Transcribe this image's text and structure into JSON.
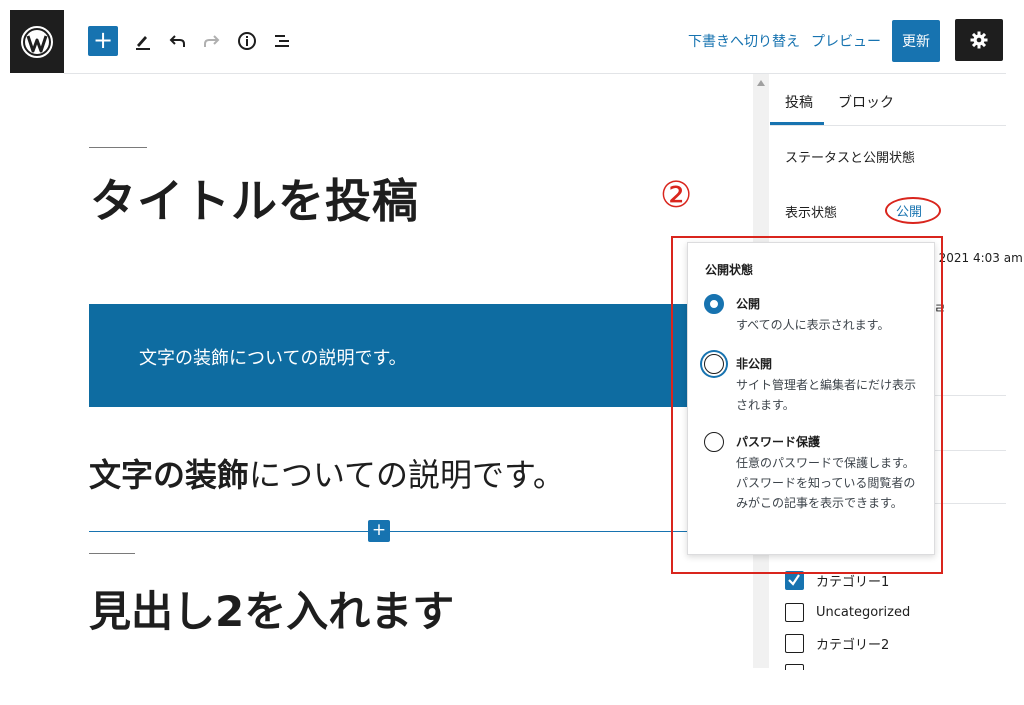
{
  "toolbar": {
    "switch_to_draft": "下書きへ切り替え",
    "preview": "プレビュー",
    "update": "更新",
    "add_symbol": "+"
  },
  "editor": {
    "title": "タイトルを投稿",
    "cover_text": "文字の装飾についての説明です。",
    "paragraph_bold": "文字の装飾",
    "paragraph_rest": "についての説明です。",
    "inserter_symbol": "+",
    "heading2": "見出し2を入れます"
  },
  "sidebar": {
    "tabs": [
      "投稿",
      "ブロック"
    ],
    "status_panel_title": "ステータスと公開状態",
    "visibility_label": "表示状態",
    "visibility_value": "公開",
    "publish_date_partial": ", 2021 4:03 am",
    "obscured_char": "ㄹ"
  },
  "annotation": {
    "step_marker": "②"
  },
  "visibility_popover": {
    "title": "公開状態",
    "options": [
      {
        "label": "公開",
        "description": "すべての人に表示されます。",
        "selected": true
      },
      {
        "label": "非公開",
        "description": "サイト管理者と編集者にだけ表示されます。",
        "selected": false
      },
      {
        "label": "パスワード保護",
        "description": "任意のパスワードで保護します。パスワードを知っている閲覧者のみがこの記事を表示できます。",
        "selected": false
      }
    ]
  },
  "categories": [
    {
      "label": "カテゴリー1",
      "checked": true
    },
    {
      "label": "Uncategorized",
      "checked": false
    },
    {
      "label": "カテゴリー2",
      "checked": false
    }
  ],
  "colors": {
    "accent": "#1773b0",
    "cover_bg": "#0e6ca1",
    "highlight_red": "#d9251d",
    "dark": "#1e1e1e"
  },
  "icons": {
    "logo": "wordpress-logo-icon",
    "tools": [
      "pencil-icon",
      "undo-icon",
      "redo-icon",
      "info-icon",
      "list-view-icon"
    ],
    "settings": "gear-icon"
  }
}
